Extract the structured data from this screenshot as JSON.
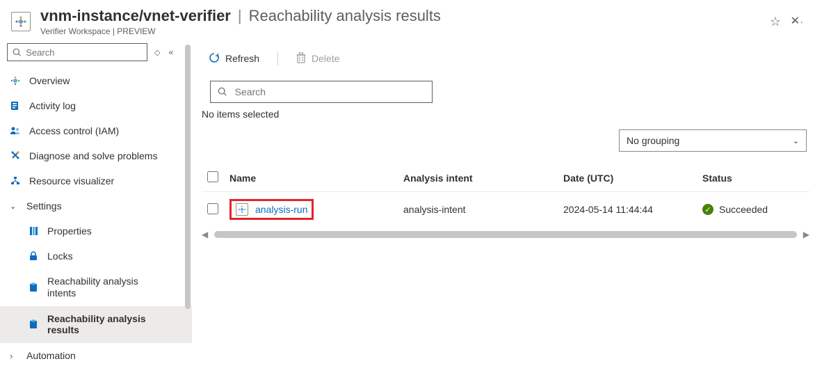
{
  "header": {
    "resource_path": "vnm-instance/vnet-verifier",
    "page_title": "Reachability analysis results",
    "subtext": "Verifier Workspace | PREVIEW",
    "star_tooltip": "Favorite",
    "more_tooltip": "More"
  },
  "sidebar": {
    "search_placeholder": "Search",
    "items": {
      "overview": "Overview",
      "activity": "Activity log",
      "iam": "Access control (IAM)",
      "diagnose": "Diagnose and solve problems",
      "resviz": "Resource visualizer",
      "settings": "Settings",
      "properties": "Properties",
      "locks": "Locks",
      "intents": "Reachability analysis intents",
      "results": "Reachability analysis results",
      "automation": "Automation"
    }
  },
  "commands": {
    "refresh": "Refresh",
    "delete": "Delete"
  },
  "filter": {
    "placeholder": "Search",
    "selection_text": "No items selected",
    "grouping_value": "No grouping"
  },
  "table": {
    "col_name": "Name",
    "col_intent": "Analysis intent",
    "col_date": "Date (UTC)",
    "col_status": "Status",
    "rows": [
      {
        "name": "analysis-run",
        "intent": "analysis-intent",
        "date": "2024-05-14 11:44:44",
        "status": "Succeeded"
      }
    ]
  }
}
